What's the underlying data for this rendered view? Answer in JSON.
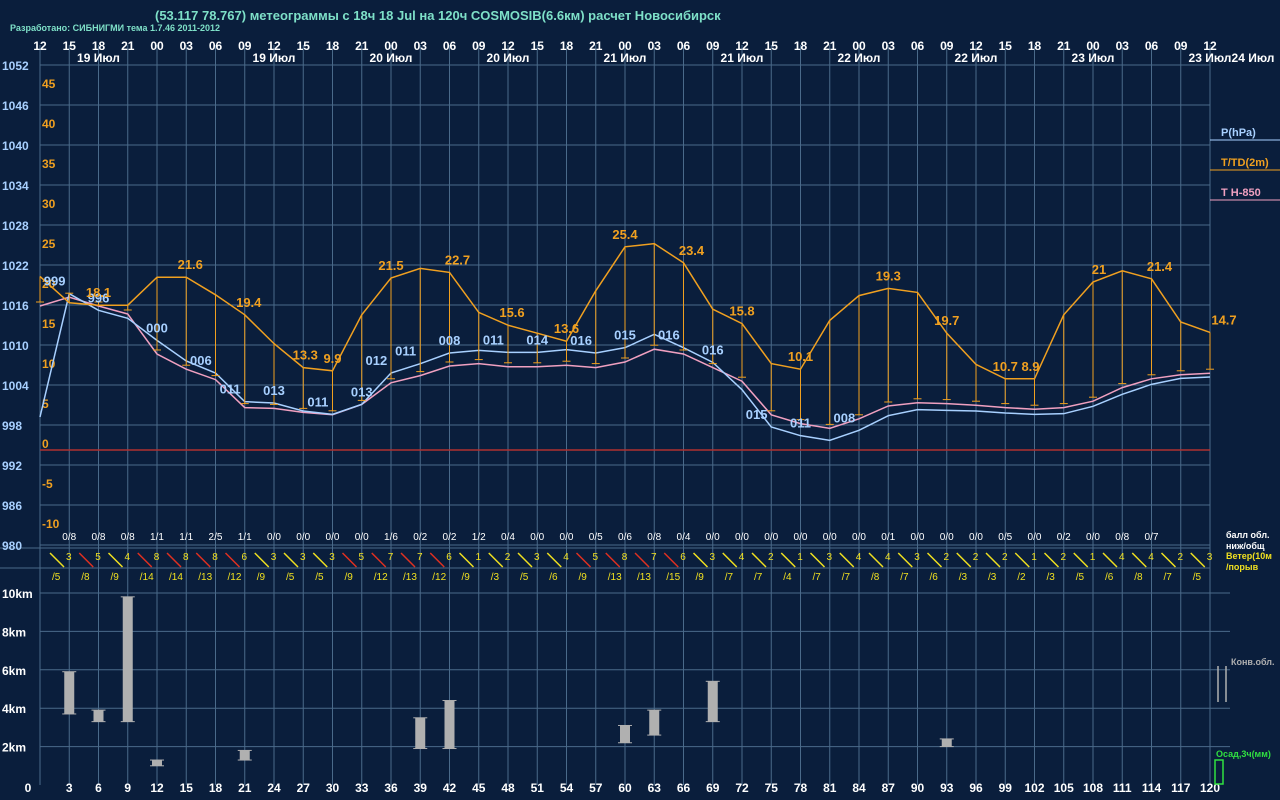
{
  "header": {
    "title": "(53.117 78.767) метеограммы с  18ч 18 Jul на 120ч COSMOSIB(6.6км) расчет Новосибирск",
    "credit": "Разработано: СИБНИГМИ тема 1.7.46 2011-2012"
  },
  "colors": {
    "background": "#0a1e3c",
    "grid": "#4a6a8a",
    "pressure": "#a8d0ff",
    "temperature": "#f0a020",
    "t850": "#f0a0c0",
    "wind_yellow": "#f0e020",
    "wind_red": "#e03020",
    "cloud_bars": "#b0b0b0",
    "hours": "#ffffff",
    "legend_green": "#30e040"
  },
  "time_axis": {
    "hours": [
      "12",
      "15",
      "18",
      "21",
      "00",
      "03",
      "06",
      "09",
      "12",
      "15",
      "18",
      "21",
      "00",
      "03",
      "06",
      "09",
      "12",
      "15",
      "18",
      "21",
      "00",
      "03",
      "06",
      "09",
      "12",
      "15",
      "18",
      "21",
      "00",
      "03",
      "06",
      "09",
      "12",
      "15",
      "18",
      "21",
      "00",
      "03",
      "06",
      "09",
      "12"
    ],
    "dates": [
      "19 Июл",
      "19 Июл",
      "20 Июл",
      "20 Июл",
      "21 Июл",
      "21 Июл",
      "22 Июл",
      "22 Июл",
      "23 Июл",
      "23 Июл",
      "24 Июл"
    ],
    "forecast_hours": [
      "0",
      "3",
      "6",
      "9",
      "12",
      "15",
      "18",
      "21",
      "24",
      "27",
      "30",
      "33",
      "36",
      "39",
      "42",
      "45",
      "48",
      "51",
      "54",
      "57",
      "60",
      "63",
      "66",
      "69",
      "72",
      "75",
      "78",
      "81",
      "84",
      "87",
      "90",
      "93",
      "96",
      "99",
      "102",
      "105",
      "108",
      "111",
      "114",
      "117",
      "120"
    ]
  },
  "legend": {
    "pressure": "P(hPa)",
    "temperature": "T/TD(2m)",
    "t850": "T H-850",
    "clouds_line1": "балл обл.",
    "clouds_line2": "ниж/общ",
    "wind_line1": "Ветер(10м",
    "wind_line2": "/порыв",
    "conv_clouds": "Конв.обл.",
    "precip": "Осад,3ч(мм)"
  },
  "chart_data": [
    {
      "type": "line",
      "title": "",
      "x_hours": [
        0,
        3,
        6,
        9,
        12,
        15,
        18,
        21,
        24,
        27,
        30,
        33,
        36,
        39,
        42,
        45,
        48,
        51,
        54,
        57,
        60,
        63,
        66,
        69,
        72,
        75,
        78,
        81,
        84,
        87,
        90,
        93,
        96,
        99,
        102,
        105,
        108,
        111,
        114,
        117,
        120
      ],
      "pressure_axis": {
        "label": "P(hPa)",
        "ticks": [
          "1052",
          "1046",
          "1040",
          "1034",
          "1028",
          "1022",
          "1016",
          "1010",
          "1004",
          "998",
          "992",
          "986",
          "980"
        ],
        "ylim": [
          980,
          1052
        ]
      },
      "temperature_axis": {
        "label": "T/TD(2m)",
        "ticks": [
          "45",
          "40",
          "35",
          "30",
          "25",
          "20",
          "15",
          "10",
          "5",
          "0",
          "-5",
          "-10"
        ],
        "ylim": [
          -13,
          50
        ]
      },
      "series": [
        {
          "name": "P(hPa)",
          "values": [
            999.2,
            1017.7,
            1015.2,
            1014.0,
            1010.7,
            1007.6,
            1005.8,
            1001.5,
            1001.3,
            1000.1,
            999.6,
            1001.1,
            1005.8,
            1007.2,
            1008.8,
            1009.2,
            1008.9,
            1008.9,
            1009.3,
            1008.8,
            1009.6,
            1011.6,
            1009.6,
            1007.4,
            1003.3,
            997.7,
            996.4,
            995.7,
            997.2,
            999.4,
            1000.3,
            1000.2,
            1000.1,
            999.8,
            999.6,
            999.7,
            1000.8,
            1002.6,
            1004.1,
            1005.0,
            1005.2
          ]
        },
        {
          "name": "T/TD(2m)",
          "values": [
            21.7,
            18.4,
            18.1,
            18.1,
            21.6,
            21.6,
            19.4,
            16.9,
            13.3,
            10.3,
            9.9,
            16.9,
            21.5,
            22.7,
            22.2,
            17.2,
            15.6,
            14.6,
            13.6,
            19.9,
            25.4,
            25.8,
            23.4,
            17.6,
            15.8,
            10.8,
            10.1,
            16.2,
            19.3,
            20.2,
            19.7,
            14.6,
            10.7,
            8.9,
            8.9,
            16.9,
            21.0,
            22.4,
            21.4,
            16.0,
            14.7
          ]
        },
        {
          "name": "T H-850",
          "values": [
            18.0,
            19.1,
            18.0,
            17.0,
            12.0,
            10.1,
            8.8,
            5.3,
            5.2,
            4.7,
            4.4,
            5.7,
            8.4,
            9.3,
            10.5,
            10.8,
            10.4,
            10.4,
            10.6,
            10.3,
            11.0,
            12.6,
            12.0,
            10.3,
            8.6,
            4.4,
            3.3,
            2.7,
            3.9,
            5.5,
            5.9,
            5.8,
            5.6,
            5.3,
            5.1,
            5.3,
            6.1,
            7.8,
            8.9,
            9.4,
            9.6
          ]
        }
      ],
      "value_labels": [
        "999",
        "996",
        "000",
        "006",
        "011",
        "013",
        "011",
        "013",
        "012",
        "011",
        "008",
        "011",
        "014",
        "016",
        "015",
        "016",
        "016",
        "015",
        "011",
        "008",
        "18.1",
        "21.6",
        "19.4",
        "13.3",
        "9.9",
        "21.5",
        "22.7",
        "15.6",
        "13.6",
        "25.4",
        "23.4",
        "15.8",
        "10.1",
        "19.3",
        "19.7",
        "10.7",
        "8.9",
        "21",
        "21.4",
        "14.7"
      ],
      "clouds": [
        "0/8",
        "0/8",
        "0/8",
        "1/1",
        "1/1",
        "2/5",
        "1/1",
        "0/0",
        "0/0",
        "0/0",
        "0/0",
        "1/6",
        "0/2",
        "0/2",
        "1/2",
        "0/4",
        "0/0",
        "0/0",
        "0/5",
        "0/6",
        "0/8",
        "0/4",
        "0/0",
        "0/0",
        "0/0",
        "0/0",
        "0/0",
        "0/0",
        "0/1",
        "0/0",
        "0/0",
        "0/0",
        "0/5",
        "0/0",
        "0/2",
        "0/0",
        "0/8",
        "0/7"
      ],
      "wind_mean": [
        "3",
        "5",
        "4",
        "8",
        "8",
        "8",
        "6",
        "3",
        "3",
        "3",
        "5",
        "7",
        "7",
        "6",
        "1",
        "2",
        "3",
        "4",
        "5",
        "8",
        "7",
        "6",
        "3",
        "4",
        "2",
        "1",
        "3",
        "4",
        "4",
        "3",
        "2",
        "2",
        "2",
        "1",
        "2",
        "1",
        "4",
        "4",
        "2",
        "3"
      ],
      "wind_gust": [
        "/5",
        "/8",
        "/9",
        "/14",
        "/14",
        "/13",
        "/12",
        "/9",
        "/5",
        "/5",
        "/9",
        "/12",
        "/13",
        "/12",
        "/9",
        "/3",
        "/5",
        "/6",
        "/9",
        "/13",
        "/13",
        "/15",
        "/9",
        "/7",
        "/7",
        "/4",
        "/7",
        "/7",
        "/8",
        "/7",
        "/6",
        "/3",
        "/3",
        "/2",
        "/3",
        "/5",
        "/6",
        "/8",
        "/7",
        "/5"
      ]
    },
    {
      "type": "bar",
      "title": "",
      "ylabel": "",
      "y_ticks": [
        "10km",
        "8km",
        "6km",
        "4km",
        "2km"
      ],
      "ylim": [
        0,
        10.5
      ],
      "bars_km": [
        {
          "hour": 3,
          "bottom": 3.7,
          "top": 5.9
        },
        {
          "hour": 6,
          "bottom": 3.3,
          "top": 3.9
        },
        {
          "hour": 9,
          "bottom": 3.3,
          "top": 9.8
        },
        {
          "hour": 12,
          "bottom": 1.0,
          "top": 1.3
        },
        {
          "hour": 21,
          "bottom": 1.3,
          "top": 1.8
        },
        {
          "hour": 39,
          "bottom": 1.9,
          "top": 3.5
        },
        {
          "hour": 42,
          "bottom": 1.9,
          "top": 4.4
        },
        {
          "hour": 60,
          "bottom": 2.2,
          "top": 3.1
        },
        {
          "hour": 63,
          "bottom": 2.6,
          "top": 3.9
        },
        {
          "hour": 69,
          "bottom": 3.3,
          "top": 5.4
        },
        {
          "hour": 93,
          "bottom": 2.0,
          "top": 2.4
        }
      ]
    }
  ]
}
